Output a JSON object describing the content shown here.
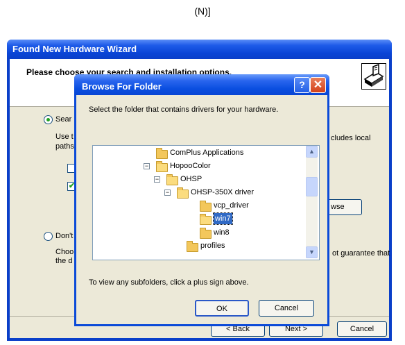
{
  "caption": "(N)]",
  "wizard": {
    "title": "Found New Hardware Wizard",
    "heading": "Please choose your search and installation options.",
    "search_option_prefix": "Sear",
    "use_text_prefix": "Use t",
    "paths_text": "paths",
    "includes_local_text": "cludes local",
    "browse_partial": "wse",
    "dont_option_prefix": "Don't",
    "choose_text_prefix": "Choo",
    "the_d_text": "the d",
    "guarantee_text": "ot guarantee that",
    "back_partial": "< Back",
    "next_partial": "Next >",
    "cancel_label": "Cancel"
  },
  "dialog": {
    "title": "Browse For Folder",
    "help_label": "?",
    "close_label": "✕",
    "instruction": "Select the folder that contains drivers for your hardware.",
    "tree": [
      {
        "label": "ComPlus Applications",
        "expander": "",
        "open": false,
        "selected": false
      },
      {
        "label": "HopooColor",
        "expander": "−",
        "open": true,
        "selected": false
      },
      {
        "label": "OHSP",
        "expander": "−",
        "open": true,
        "selected": false
      },
      {
        "label": "OHSP-350X driver",
        "expander": "−",
        "open": true,
        "selected": false
      },
      {
        "label": "vcp_driver",
        "expander": "",
        "open": false,
        "selected": false
      },
      {
        "label": "win7",
        "expander": "",
        "open": true,
        "selected": true
      },
      {
        "label": "win8",
        "expander": "",
        "open": false,
        "selected": false
      },
      {
        "label": "profiles",
        "expander": "",
        "open": false,
        "selected": false
      }
    ],
    "hint": "To view any subfolders, click a plus sign above.",
    "ok_label": "OK",
    "cancel_label": "Cancel"
  }
}
